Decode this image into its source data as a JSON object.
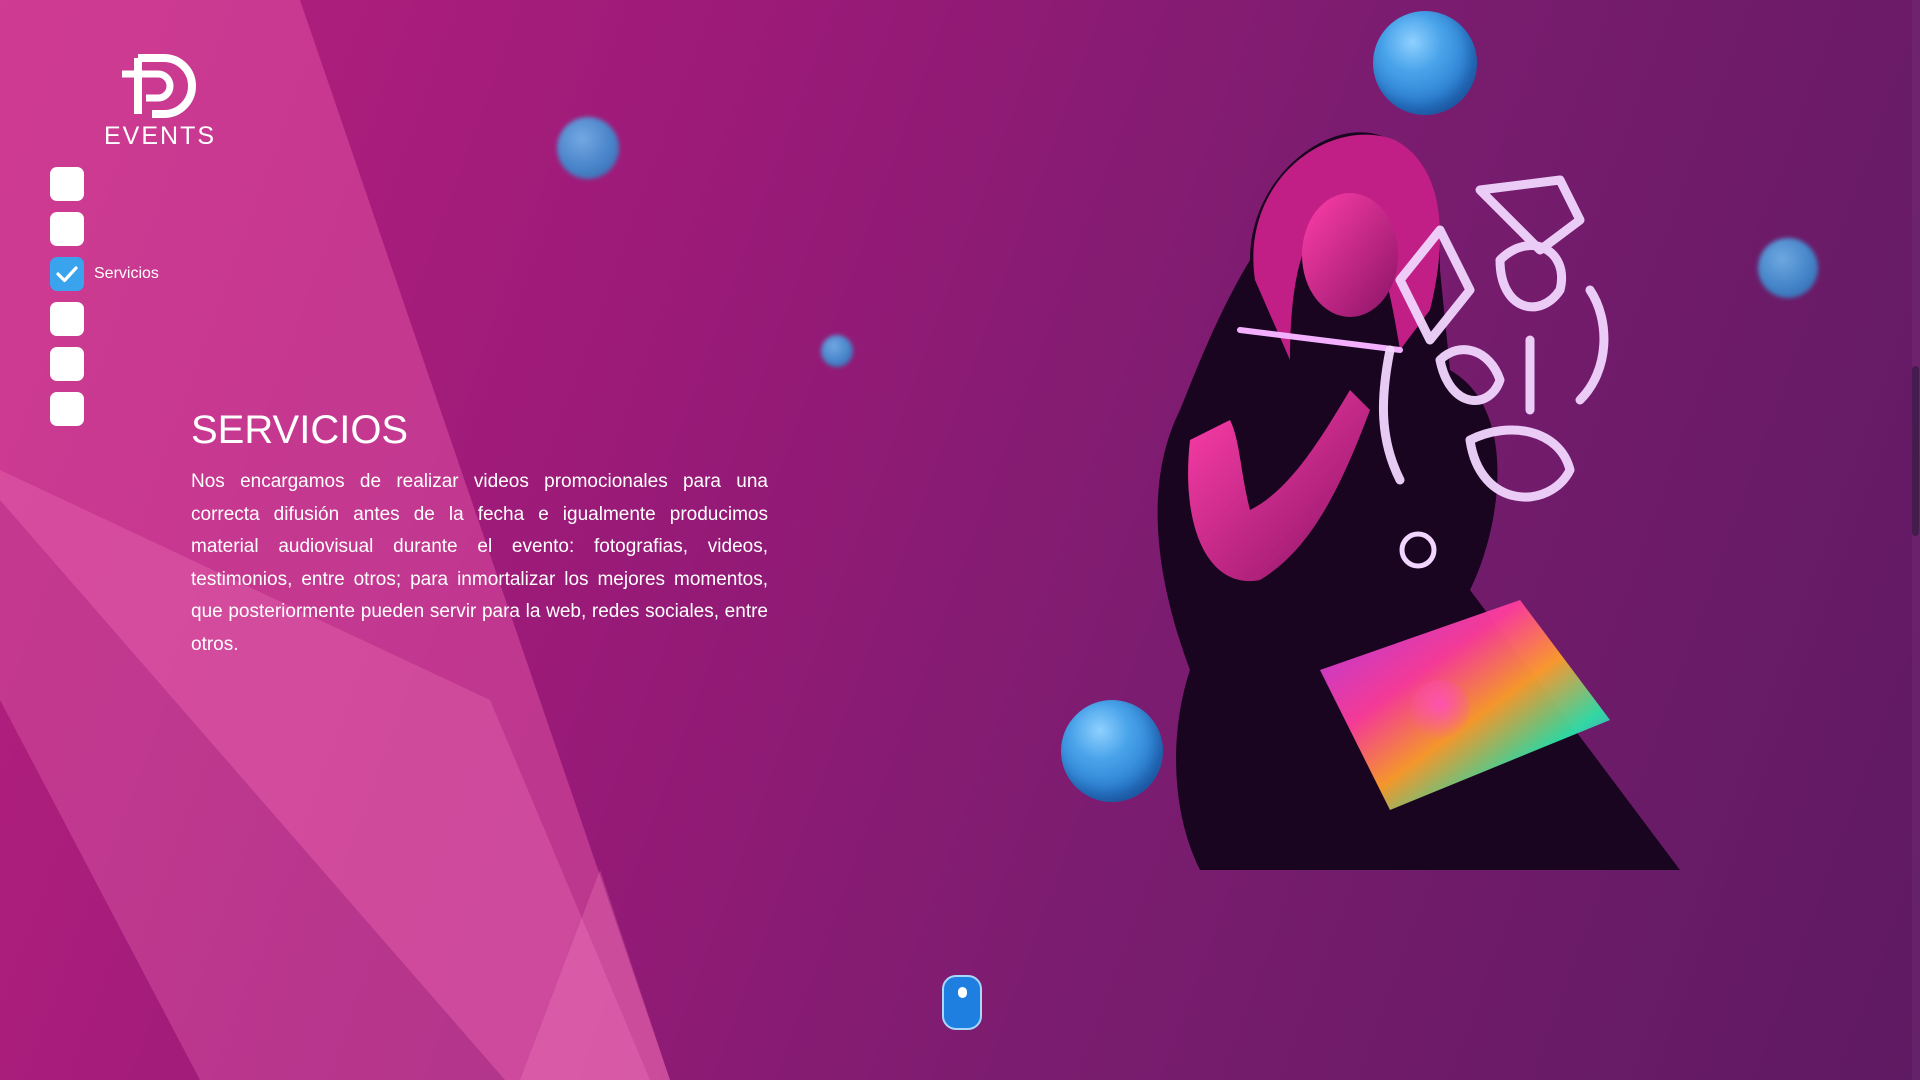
{
  "brand": {
    "logo_text": "EVENTS"
  },
  "nav": {
    "items": [
      {
        "label": "",
        "checked": false
      },
      {
        "label": "",
        "checked": false
      },
      {
        "label": "Servicios",
        "checked": true
      },
      {
        "label": "",
        "checked": false
      },
      {
        "label": "",
        "checked": false
      },
      {
        "label": "",
        "checked": false
      }
    ]
  },
  "section": {
    "title": "SERVICIOS",
    "body": "Nos encargamos de realizar videos promocionales para una correcta difusión antes de la fecha e igualmente producimos material audiovisual durante el evento: fotografias, videos, testimonios, entre otros; para inmortalizar los mejores momentos, que posteriormente pueden servir para la web, redes sociales, entre otros."
  },
  "colors": {
    "accent": "#39a3ee",
    "background_start": "#b8207e",
    "background_end": "#5e1a62",
    "sphere": "#3f8fd2"
  },
  "icons": {
    "checkbox_checked": "check-icon",
    "scroll_indicator": "mouse-scroll-icon"
  }
}
